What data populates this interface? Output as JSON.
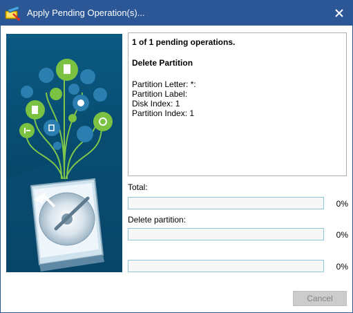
{
  "window": {
    "title": "Apply Pending Operations(s)...",
    "title_display": "Apply Pending Operation(s)...",
    "accent_color": "#2b5797"
  },
  "info": {
    "header": "1 of 1 pending operations.",
    "operation": "Delete Partition",
    "details": [
      "Partition Letter: *:",
      "Partition Label:",
      "Disk Index: 1",
      "Partition Index: 1"
    ]
  },
  "progress": {
    "total_label": "Total:",
    "total_value": 0,
    "total_text": "0%",
    "current_label": "Delete partition:",
    "current_value": 0,
    "current_text": "0%",
    "third_value": 0,
    "third_text": "0%"
  },
  "buttons": {
    "cancel": "Cancel"
  }
}
